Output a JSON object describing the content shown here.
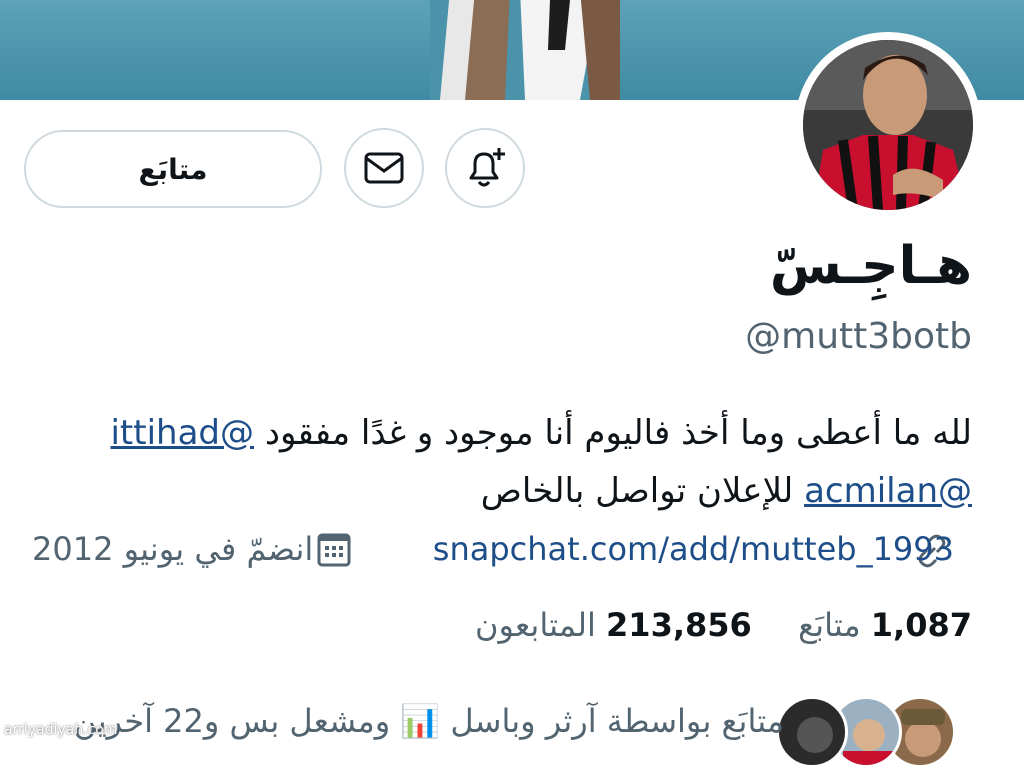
{
  "profile": {
    "display_name": "هـاجِـسّ",
    "handle": "@mutt3botb",
    "bio_line1_text": "لله ما أعطى وما أخذ فاليوم أنا موجود و غدًا مفقود",
    "bio_mention1": "@ittihad",
    "bio_mention2": "@acmilan",
    "bio_line2_text": "للإعلان تواصل بالخاص",
    "website": "snapchat.com/add/mutteb_1993",
    "joined": "انضمّ في يونيو 2012"
  },
  "actions": {
    "follow_label": "متابَع",
    "message_icon": "mail-icon",
    "notify_icon": "bell-plus-icon"
  },
  "stats": {
    "following_count": "1,087",
    "following_label": "متابَع",
    "followers_count": "213,856",
    "followers_label": "المتابعون"
  },
  "followed_by": {
    "text": "متابَع بواسطة آرثر وباسل 📊 ومشعل بس و22 آخرين"
  },
  "watermark": "arriyadiyah.com",
  "colors": {
    "banner": "#4894ad",
    "link": "#1d4e89",
    "secondary_text": "#536471",
    "border": "#cfd9de"
  }
}
